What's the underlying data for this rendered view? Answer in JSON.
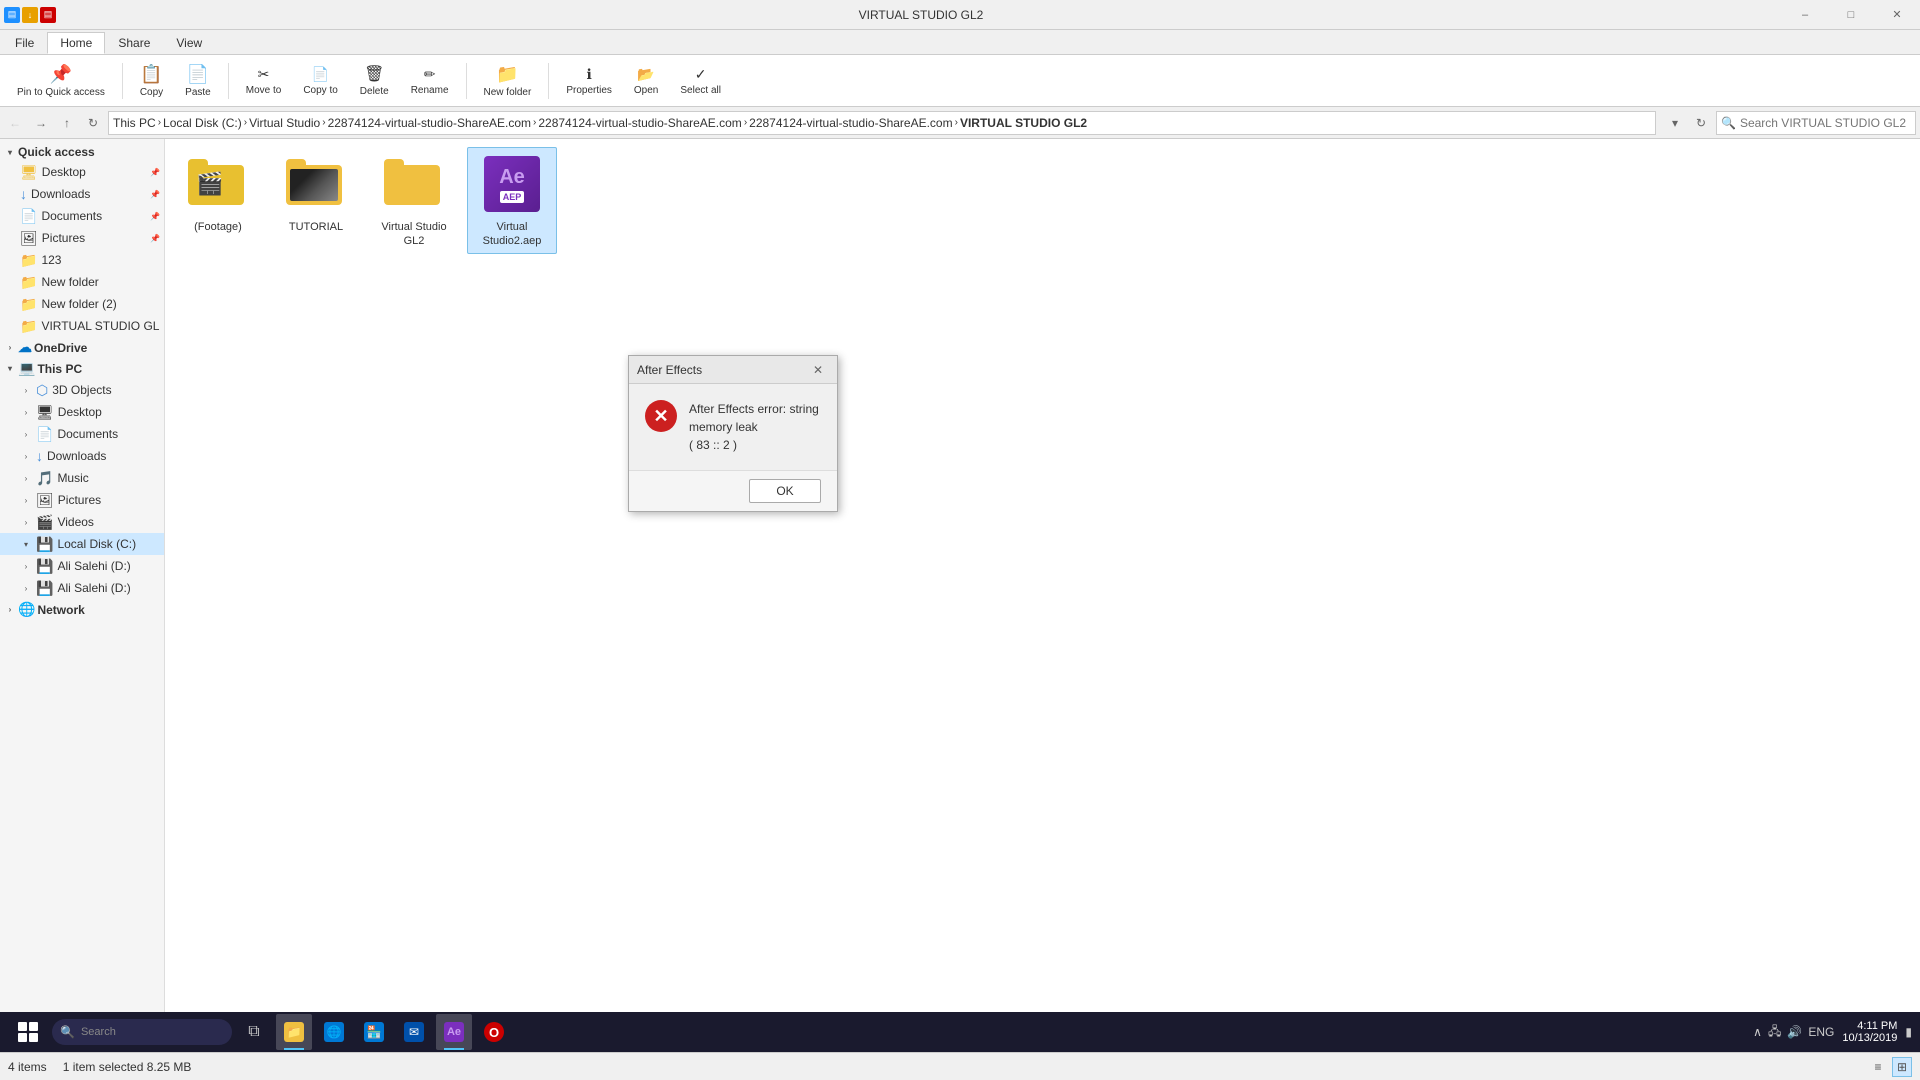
{
  "titlebar": {
    "title": "VIRTUAL STUDIO GL2",
    "minimize_label": "–",
    "maximize_label": "□",
    "close_label": "✕"
  },
  "ribbon": {
    "tabs": [
      "File",
      "Home",
      "Share",
      "View"
    ],
    "active_tab": "Home"
  },
  "addressbar": {
    "back_btn": "←",
    "forward_btn": "→",
    "up_btn": "↑",
    "refresh_btn": "↻",
    "crumbs": [
      "This PC",
      "Local Disk (C:)",
      "Virtual Studio",
      "22874124-virtual-studio-ShareAE.com",
      "22874124-virtual-studio-ShareAE.com",
      "22874124-virtual-studio-ShareAE.com",
      "VIRTUAL STUDIO GL2"
    ],
    "search_placeholder": "Search VIRTUAL STUDIO GL2"
  },
  "sidebar": {
    "quick_access_label": "Quick access",
    "quick_access_items": [
      {
        "label": "Desktop",
        "pinned": true
      },
      {
        "label": "Downloads",
        "pinned": true
      },
      {
        "label": "Documents",
        "pinned": true
      },
      {
        "label": "Pictures",
        "pinned": true
      },
      {
        "label": "123"
      },
      {
        "label": "New folder"
      },
      {
        "label": "New folder (2)"
      },
      {
        "label": "VIRTUAL STUDIO GL"
      }
    ],
    "onedrive_label": "OneDrive",
    "this_pc_label": "This PC",
    "this_pc_items": [
      {
        "label": "3D Objects"
      },
      {
        "label": "Desktop"
      },
      {
        "label": "Documents"
      },
      {
        "label": "Downloads"
      },
      {
        "label": "Music"
      },
      {
        "label": "Pictures"
      },
      {
        "label": "Videos"
      },
      {
        "label": "Local Disk (C:)",
        "active": true
      },
      {
        "label": "Ali Salehi (D:)"
      },
      {
        "label": "Ali Salehi (D:)"
      }
    ],
    "network_label": "Network"
  },
  "files": [
    {
      "name": "(Footage)",
      "type": "footage-folder"
    },
    {
      "name": "TUTORIAL",
      "type": "tutorial-folder"
    },
    {
      "name": "Virtual Studio GL2",
      "type": "folder"
    },
    {
      "name": "Virtual Studio2.aep",
      "type": "aep",
      "selected": true
    }
  ],
  "statusbar": {
    "items_count": "4 items",
    "selected_info": "1 item selected  8.25 MB"
  },
  "dialog": {
    "title": "After Effects",
    "error_icon": "✕",
    "message_line1": "After Effects error: string memory leak",
    "message_line2": "( 83 :: 2 )",
    "ok_label": "OK"
  },
  "taskbar": {
    "search_placeholder": "Search",
    "apps": [
      {
        "icon": "⊞",
        "label": "",
        "type": "start"
      },
      {
        "icon": "🔍",
        "label": "",
        "type": "search"
      },
      {
        "icon": "⊡",
        "label": "",
        "type": "task-view"
      },
      {
        "icon": "📁",
        "label": "File Explorer",
        "active": true,
        "color": "#f0c040"
      },
      {
        "icon": "🌐",
        "label": "Edge",
        "active": false,
        "color": "#0078d4"
      },
      {
        "icon": "⊞",
        "label": "Store",
        "active": false,
        "color": "#0078d4"
      },
      {
        "icon": "✉",
        "label": "Mail",
        "active": false,
        "color": "#0078d4"
      },
      {
        "icon": "Ae",
        "label": "After Effects",
        "active": true,
        "color": "#9b59b6"
      },
      {
        "icon": "O",
        "label": "Opera",
        "active": false,
        "color": "#cc0000"
      }
    ],
    "tray": {
      "time": "4:11 PM",
      "date": "10/13/2019",
      "language": "ENG"
    }
  }
}
